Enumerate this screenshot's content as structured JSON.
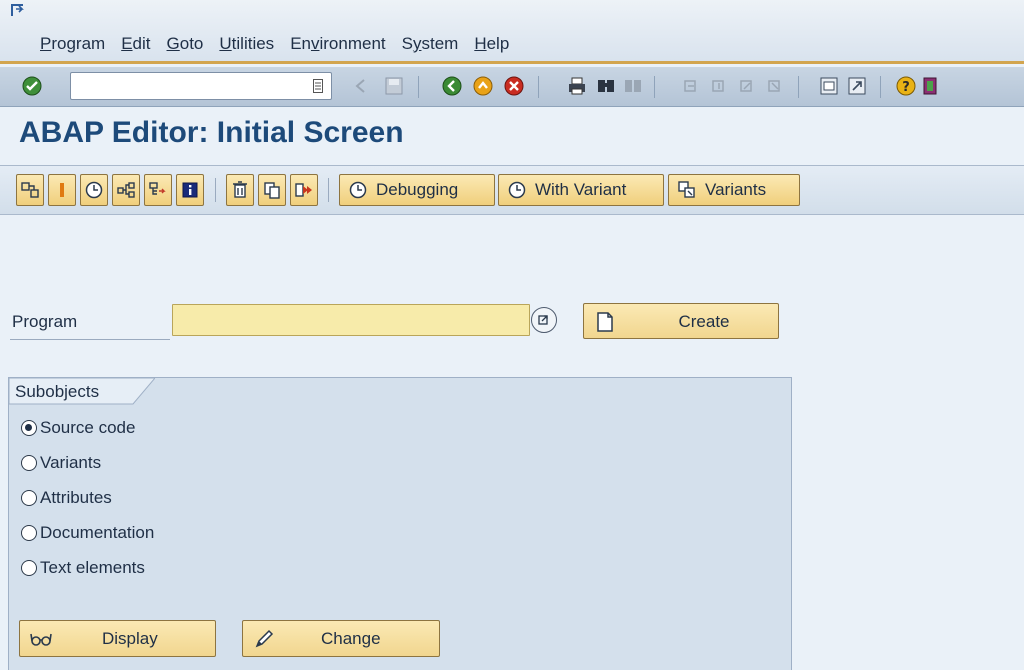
{
  "menu": {
    "items": [
      {
        "pre": "",
        "u": "P",
        "post": "rogram"
      },
      {
        "pre": "",
        "u": "E",
        "post": "dit"
      },
      {
        "pre": "",
        "u": "G",
        "post": "oto"
      },
      {
        "pre": "",
        "u": "U",
        "post": "tilities"
      },
      {
        "pre": "En",
        "u": "v",
        "post": "ironment"
      },
      {
        "pre": "S",
        "u": "y",
        "post": "stem"
      },
      {
        "pre": "",
        "u": "H",
        "post": "elp"
      }
    ]
  },
  "system_toolbar": {
    "command_value": "",
    "icons": [
      "enter-icon",
      "back-icon",
      "exit-icon",
      "cancel-icon",
      "print-icon",
      "find-icon",
      "help-icon"
    ]
  },
  "title": "ABAP Editor: Initial Screen",
  "app_toolbar": {
    "debugging_label": "Debugging",
    "with_variant_label": "With Variant",
    "variants_label": "Variants"
  },
  "program": {
    "label": "Program",
    "value": "",
    "create_label": "Create"
  },
  "subobjects": {
    "title": "Subobjects",
    "options": [
      {
        "label": "Source code",
        "selected": true
      },
      {
        "label": "Variants",
        "selected": false
      },
      {
        "label": "Attributes",
        "selected": false
      },
      {
        "label": "Documentation",
        "selected": false
      },
      {
        "label": "Text elements",
        "selected": false
      }
    ],
    "display_label": "Display",
    "change_label": "Change"
  },
  "colors": {
    "accent_title": "#1d4a7a",
    "button_yellow": "#f1d68f",
    "input_required": "#f7ebaa"
  }
}
